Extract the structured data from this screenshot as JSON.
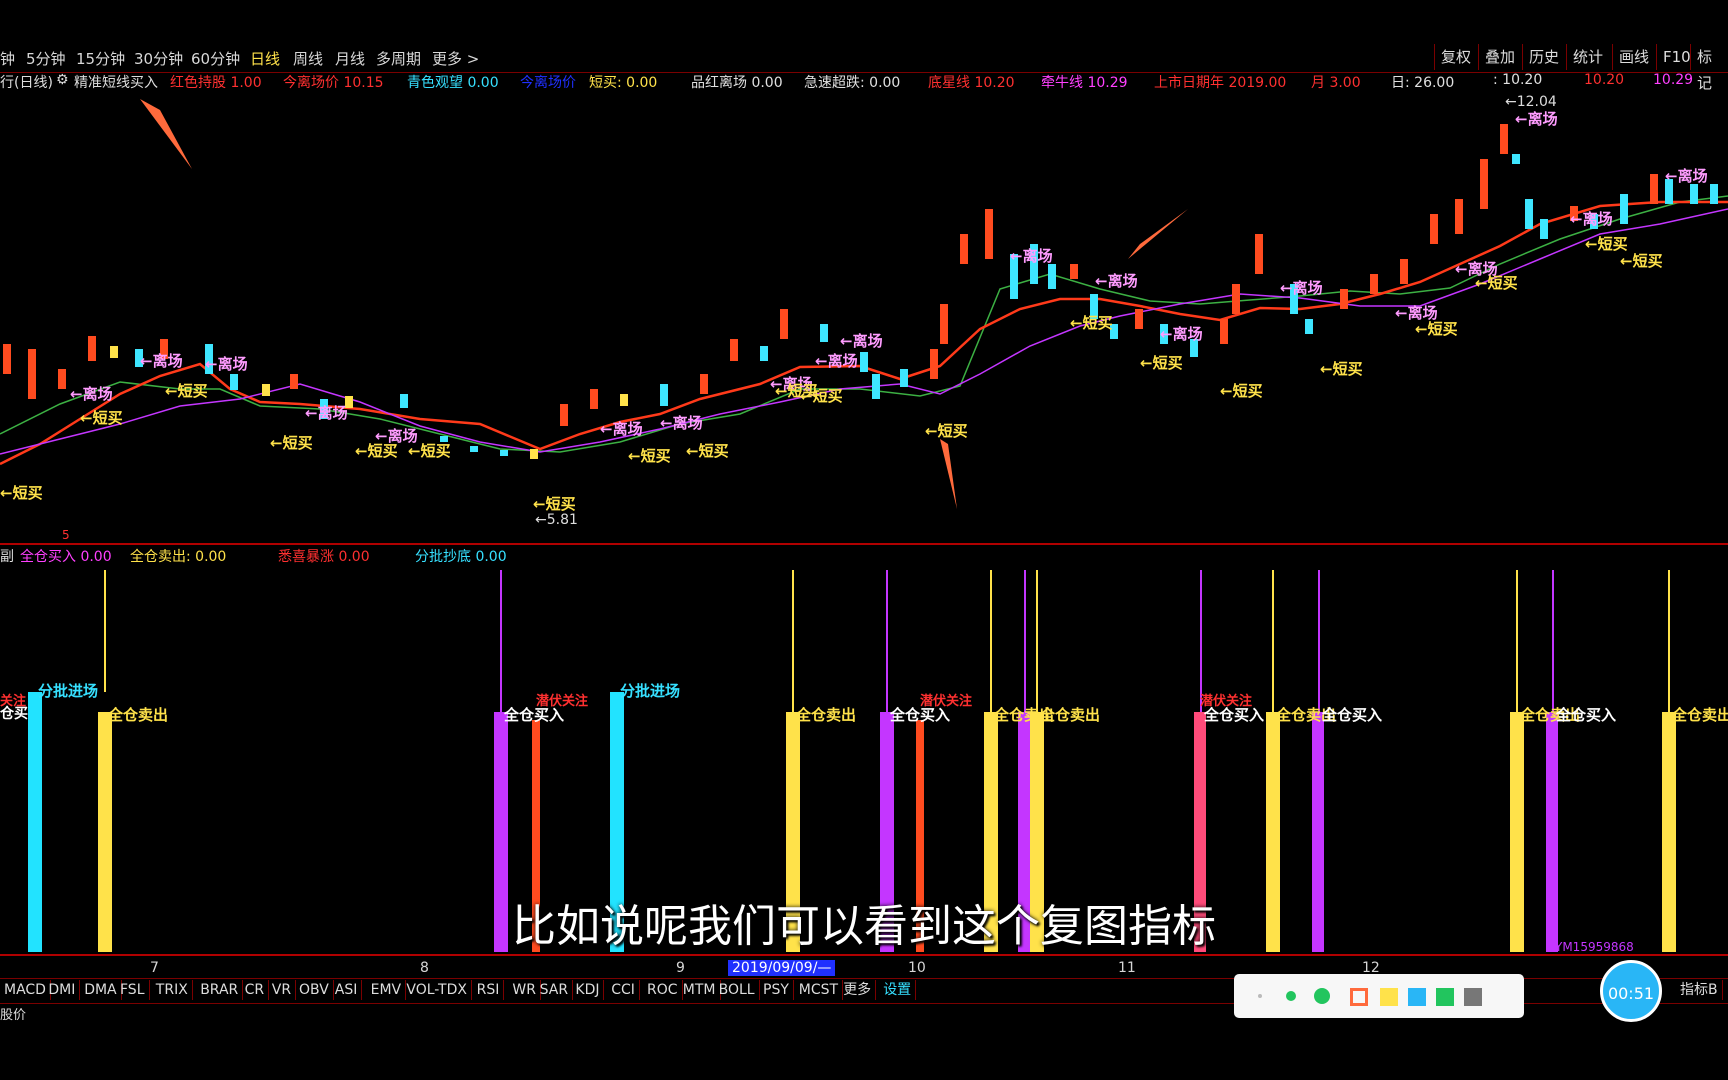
{
  "toolbar": {
    "timeframes": [
      "钟",
      "5分钟",
      "15分钟",
      "30分钟",
      "60分钟",
      "日线",
      "周线",
      "月线",
      "多周期",
      "更多 >"
    ],
    "active": "日线",
    "right_buttons": [
      "复权",
      "叠加",
      "历史",
      "统计",
      "画线",
      "F10",
      "标记"
    ]
  },
  "indicator_row": {
    "name": "行(日线)",
    "formula": "精准短线买入",
    "items": [
      {
        "label": "红色持股",
        "value": "1.00",
        "color": "#ff3030"
      },
      {
        "label": "今离场价",
        "value": "10.15",
        "color": "#ff3030"
      },
      {
        "label": "青色观望",
        "value": "0.00",
        "color": "#36e0ff"
      },
      {
        "label": "今离场价",
        "value": "",
        "color": "#2030ff"
      },
      {
        "label": "短买:",
        "value": "0.00",
        "color": "#ffe24a"
      },
      {
        "label": "品红离场",
        "value": "0.00",
        "color": "#e0e0e0"
      },
      {
        "label": "急速超跌:",
        "value": "0.00",
        "color": "#e0e0e0"
      },
      {
        "label": "底星线",
        "value": "10.20",
        "color": "#ff3030"
      },
      {
        "label": "牵牛线",
        "value": "10.29",
        "color": "#ff40ff"
      },
      {
        "label": "上市日期年",
        "value": "2019.00",
        "color": "#ff3030"
      },
      {
        "label": "月",
        "value": "3.00",
        "color": "#ff3030"
      },
      {
        "label": "日:",
        "value": "26.00",
        "color": "#e0e0e0"
      },
      {
        "label": ":",
        "value": "10.20",
        "color": "#e0e0e0"
      },
      {
        "label": "",
        "value": "10.20",
        "color": "#ff3030"
      },
      {
        "label": "",
        "value": "10.29",
        "color": "#ff40ff"
      }
    ]
  },
  "main_chart": {
    "price_high": "12.04",
    "price_low": "5.81",
    "signal_exit": "←离场",
    "signal_buy": "←短买"
  },
  "sub_indicator_row": {
    "prefix": "副",
    "marker": "5",
    "items": [
      {
        "label": "全仓买入",
        "value": "0.00",
        "color": "#ff40ff"
      },
      {
        "label": "全仓卖出:",
        "value": "0.00",
        "color": "#ffe24a"
      },
      {
        "label": "悉喜暴涨",
        "value": "0.00",
        "color": "#ff3030"
      },
      {
        "label": "分批抄底",
        "value": "0.00",
        "color": "#36e0ff"
      }
    ]
  },
  "sub_chart": {
    "labels": {
      "batch_entry": "分批进场",
      "full_sell": "全仓卖出",
      "full_buy": "全仓买入",
      "watch": "潜伏关注",
      "left_cut": "仓买"
    },
    "watermark": "YM15959868"
  },
  "dates": [
    "7",
    "8",
    "9",
    "2019/09/09/—",
    "10",
    "11",
    "12"
  ],
  "bottom_tabs": [
    "MACD",
    "DMI",
    "DMA",
    "FSL",
    "TRIX",
    "BRAR",
    "CR",
    "VR",
    "OBV",
    "ASI",
    "EMV",
    "VOL-TDX",
    "RSI",
    "WR",
    "SAR",
    "KDJ",
    "CCI",
    "ROC",
    "MTM",
    "BOLL",
    "PSY",
    "MCST",
    "更多",
    "设置"
  ],
  "right_tab": "指标B",
  "status_label": "股价",
  "subtitle": "比如说呢我们可以看到这个复图指标",
  "timer": "00:51",
  "palette_colors": [
    "#ff6a3c",
    "#ffe24a",
    "#29b6f6",
    "#22c55e",
    "#777777"
  ]
}
